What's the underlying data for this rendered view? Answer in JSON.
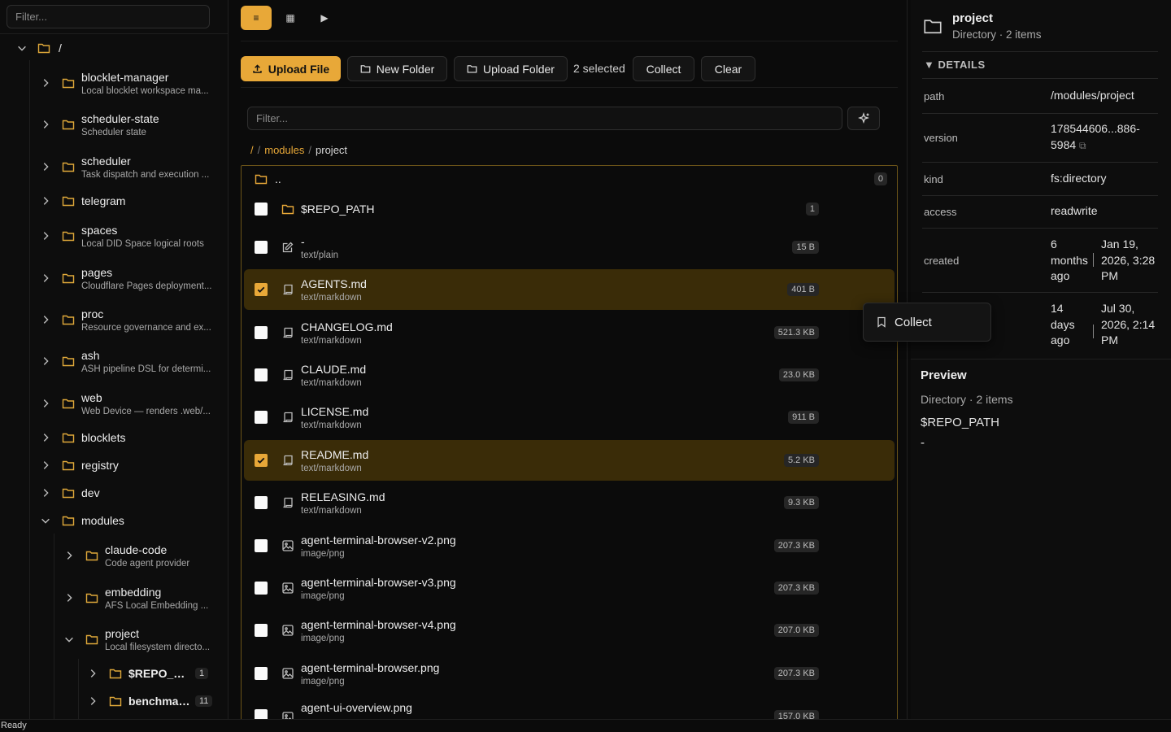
{
  "sidebar": {
    "filter_placeholder": "Filter...",
    "root_label": "/",
    "items": [
      {
        "name": "blocklet-manager",
        "desc": "Local blocklet workspace ma..."
      },
      {
        "name": "scheduler-state",
        "desc": "Scheduler state"
      },
      {
        "name": "scheduler",
        "desc": "Task dispatch and execution ..."
      },
      {
        "name": "telegram",
        "desc": ""
      },
      {
        "name": "spaces",
        "desc": "Local DID Space logical roots"
      },
      {
        "name": "pages",
        "desc": "Cloudflare Pages deployment..."
      },
      {
        "name": "proc",
        "desc": "Resource governance and ex..."
      },
      {
        "name": "ash",
        "desc": "ASH pipeline DSL for determi..."
      },
      {
        "name": "web",
        "desc": "Web Device — renders .web/..."
      },
      {
        "name": "blocklets",
        "desc": ""
      },
      {
        "name": "registry",
        "desc": ""
      },
      {
        "name": "dev",
        "desc": ""
      },
      {
        "name": "modules",
        "desc": ""
      }
    ],
    "modules_children": [
      {
        "name": "claude-code",
        "desc": "Code agent provider"
      },
      {
        "name": "embedding",
        "desc": "AFS Local Embedding ..."
      },
      {
        "name": "project",
        "desc": "Local filesystem directo..."
      }
    ],
    "project_children": [
      {
        "name": "$REPO_PA...",
        "badge": "1"
      },
      {
        "name": "benchmar...",
        "badge": "11"
      }
    ]
  },
  "toolbar": {
    "view_list": "≡",
    "view_grid": "▦",
    "view_play": "▶",
    "upload_file": "Upload File",
    "new_folder": "New Folder",
    "upload_folder": "Upload Folder",
    "selected_count": "2 selected",
    "collect": "Collect",
    "clear": "Clear"
  },
  "main": {
    "filter_placeholder": "Filter...",
    "breadcrumb": {
      "root": "/",
      "sep": "/",
      "modules": "modules",
      "current": "project"
    },
    "parent_label": "..",
    "parent_badge": "0",
    "files": [
      {
        "name": "$REPO_PATH",
        "mime": "",
        "size": "",
        "badge": "1",
        "icon": "folder-icon",
        "checked": false
      },
      {
        "name": "-",
        "mime": "text/plain",
        "size": "15 B",
        "icon": "edit-icon",
        "checked": false
      },
      {
        "name": "AGENTS.md",
        "mime": "text/markdown",
        "size": "401 B",
        "icon": "scroll-icon",
        "checked": true
      },
      {
        "name": "CHANGELOG.md",
        "mime": "text/markdown",
        "size": "521.3 KB",
        "icon": "scroll-icon",
        "checked": false
      },
      {
        "name": "CLAUDE.md",
        "mime": "text/markdown",
        "size": "23.0 KB",
        "icon": "scroll-icon",
        "checked": false
      },
      {
        "name": "LICENSE.md",
        "mime": "text/markdown",
        "size": "911 B",
        "icon": "scroll-icon",
        "checked": false
      },
      {
        "name": "README.md",
        "mime": "text/markdown",
        "size": "5.2 KB",
        "icon": "scroll-icon",
        "checked": true
      },
      {
        "name": "RELEASING.md",
        "mime": "text/markdown",
        "size": "9.3 KB",
        "icon": "scroll-icon",
        "checked": false
      },
      {
        "name": "agent-terminal-browser-v2.png",
        "mime": "image/png",
        "size": "207.3 KB",
        "icon": "image-icon",
        "checked": false
      },
      {
        "name": "agent-terminal-browser-v3.png",
        "mime": "image/png",
        "size": "207.3 KB",
        "icon": "image-icon",
        "checked": false
      },
      {
        "name": "agent-terminal-browser-v4.png",
        "mime": "image/png",
        "size": "207.0 KB",
        "icon": "image-icon",
        "checked": false
      },
      {
        "name": "agent-terminal-browser.png",
        "mime": "image/png",
        "size": "207.3 KB",
        "icon": "image-icon",
        "checked": false
      },
      {
        "name": "agent-ui-overview.png",
        "mime": "",
        "size": "157.0 KB",
        "icon": "image-icon",
        "checked": false
      }
    ]
  },
  "details": {
    "title": "project",
    "subtitle": "Directory · 2 items",
    "section_label": "▼ DETAILS",
    "rows": [
      {
        "key": "path",
        "value": "/modules/project"
      },
      {
        "key": "version",
        "value": "178544606...886-5984"
      },
      {
        "key": "kind",
        "value": "fs:directory"
      },
      {
        "key": "access",
        "value": "readwrite"
      },
      {
        "key": "created",
        "value_rel": "6 months ago",
        "value_abs": "Jan 19, 2026, 3:28 PM"
      },
      {
        "key": "",
        "value_rel": "14 days ago",
        "value_abs": "Jul 30, 2026, 2:14 PM"
      }
    ],
    "preview_title": "Preview",
    "preview_sub": "Directory · 2 items",
    "preview_items": [
      "$REPO_PATH",
      "-"
    ]
  },
  "popover": {
    "collect_label": "Collect"
  },
  "status": {
    "text": "Ready"
  },
  "colors": {
    "accent": "#e8a838",
    "selected_row": "#3a2c08",
    "background": "#0b0b0b"
  }
}
